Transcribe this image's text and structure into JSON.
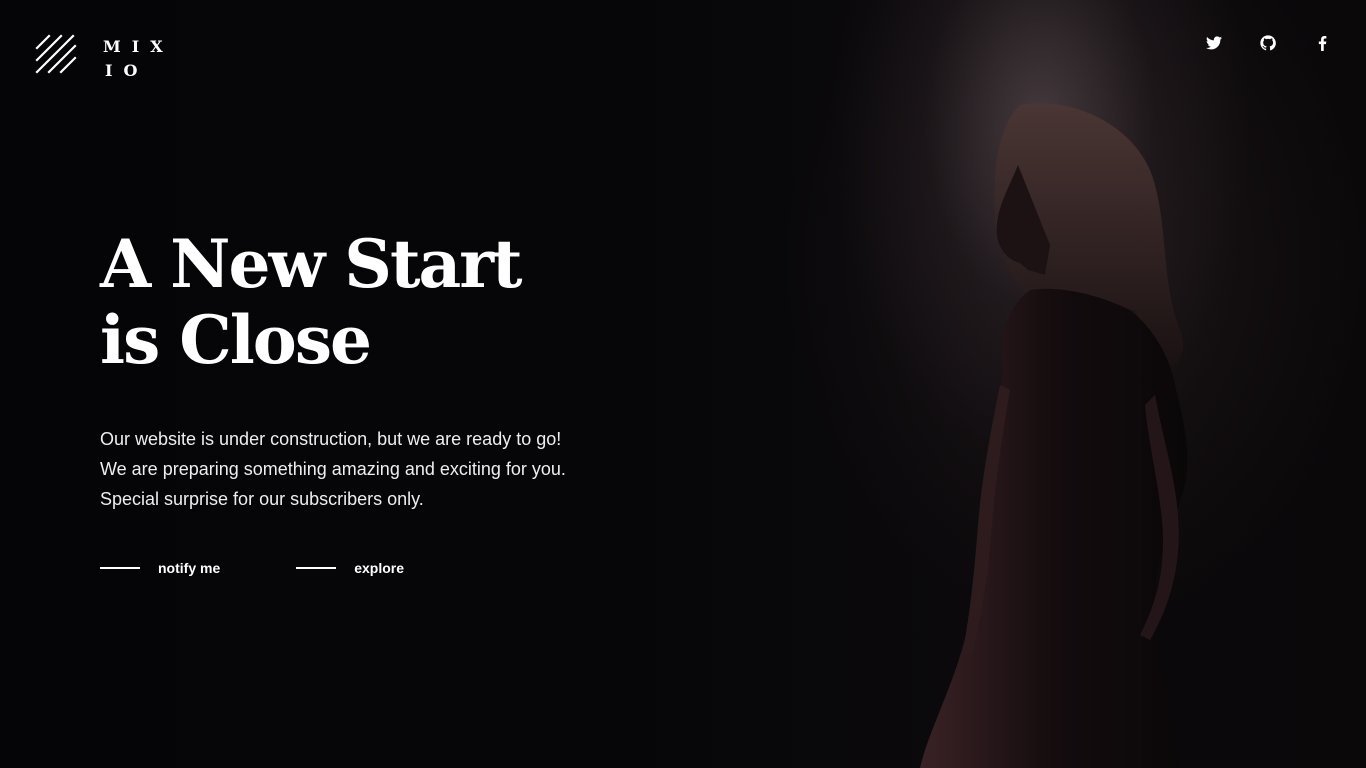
{
  "brand": {
    "logo_line1": "MIX",
    "logo_line2": "IO",
    "logo_icon": "diagonal-stripes-icon"
  },
  "social": [
    {
      "name": "twitter",
      "icon": "twitter-icon"
    },
    {
      "name": "github",
      "icon": "github-icon"
    },
    {
      "name": "facebook",
      "icon": "facebook-icon"
    }
  ],
  "hero": {
    "title_line1": "A New Start",
    "title_line2": "is Close",
    "description": "Our website is under construction, but we are ready to go! We are preparing something amazing and exciting for you. Special surprise for our subscribers only.",
    "cta_primary": "notify me",
    "cta_secondary": "explore"
  },
  "colors": {
    "background": "#050507",
    "text": "#ffffff"
  }
}
